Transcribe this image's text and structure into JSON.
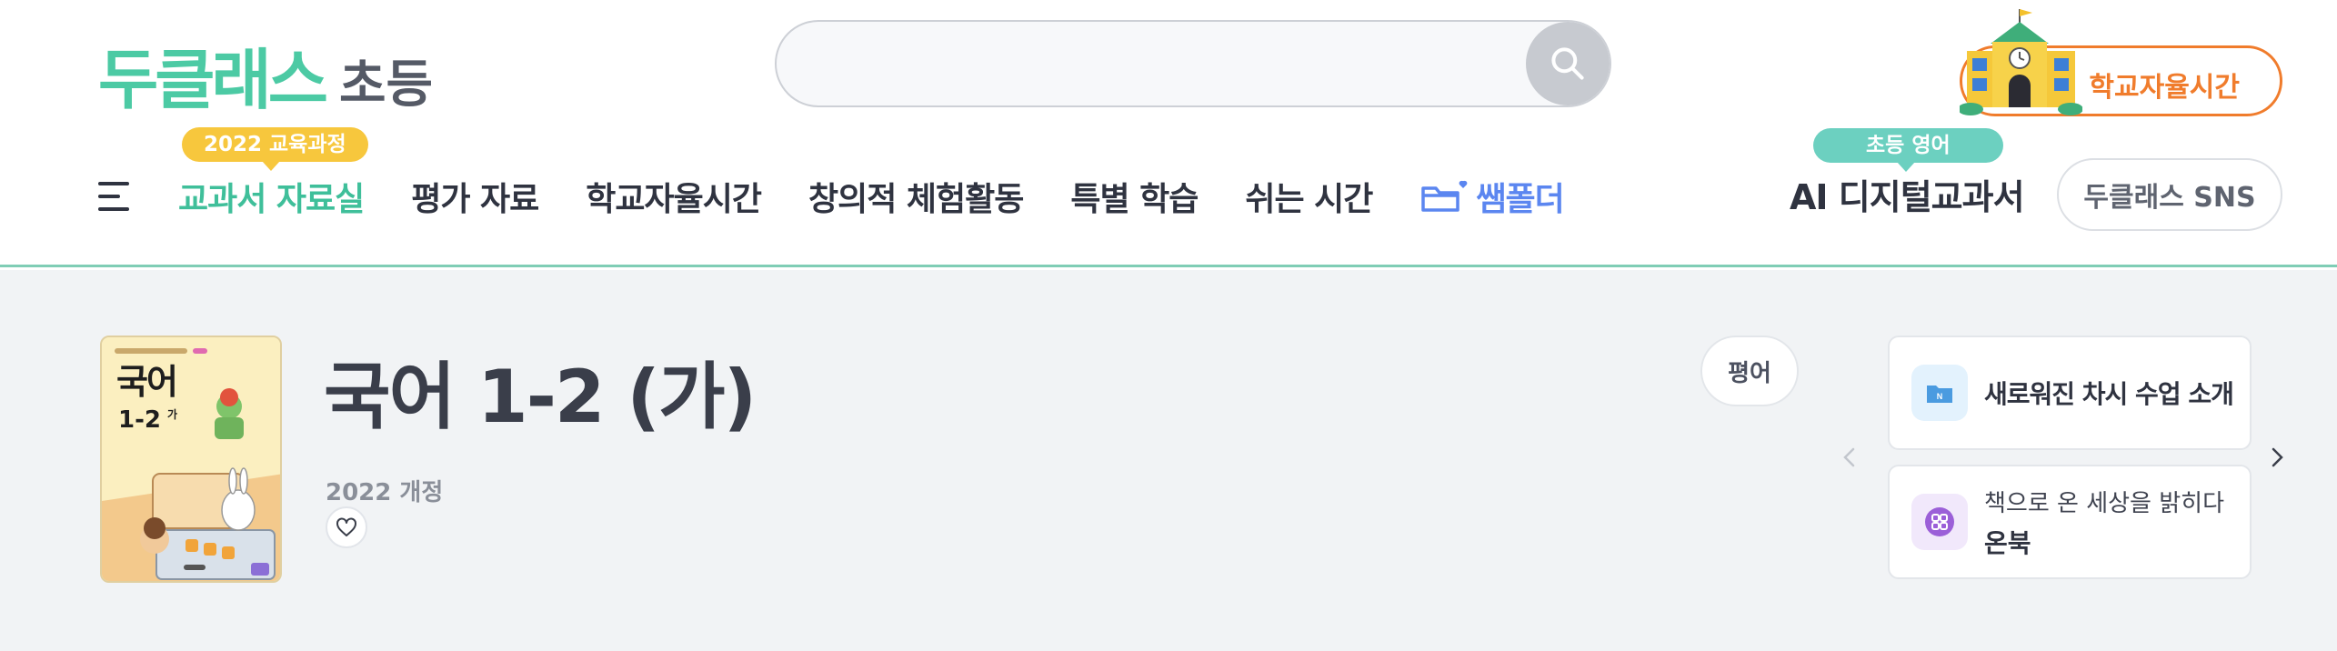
{
  "header": {
    "logo_main": "두클래스",
    "logo_sub": "초등",
    "search_placeholder": "",
    "school_cta": "학교자율시간",
    "nav_badge": "2022 교육과정",
    "nav_items": [
      {
        "label": "교과서 자료실",
        "active": true
      },
      {
        "label": "평가 자료"
      },
      {
        "label": "학교자율시간"
      },
      {
        "label": "창의적 체험활동"
      },
      {
        "label": "특별 학습"
      },
      {
        "label": "쉬는 시간"
      },
      {
        "label": "쌤폴더"
      }
    ],
    "ai_badge": "초등 영어",
    "ai_label": "AI 디지털교과서",
    "sns_button": "두클래스 SNS",
    "accent_color": "#4ccaa4"
  },
  "book": {
    "cover_title": "국어",
    "cover_grade": "1-2",
    "cover_sub": "가",
    "title": "국어 1-2 (가)",
    "edition": "2022 개정",
    "tag": "평어"
  },
  "promos": [
    {
      "title": "새로워진 차시 수업 소개",
      "icon": "folder-icon"
    },
    {
      "subtitle": "책으로 온 세상을 밝히다",
      "title": "온북",
      "icon": "onbook-icon"
    }
  ]
}
